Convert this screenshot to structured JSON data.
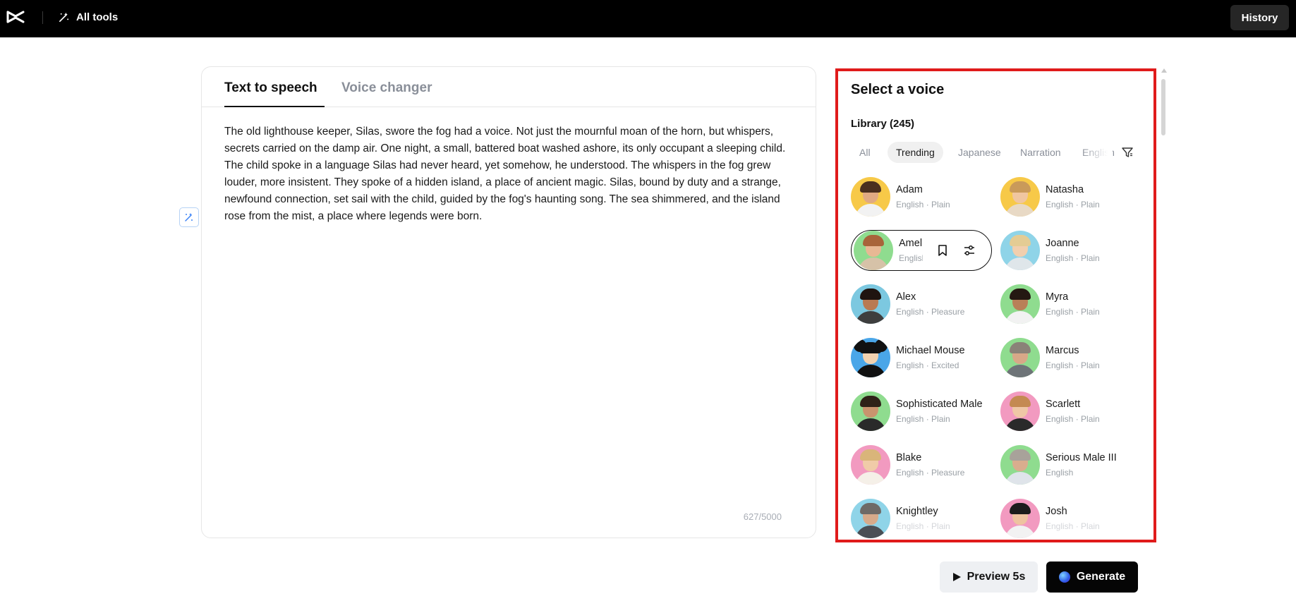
{
  "topbar": {
    "logo_icon": "capcut-logo-icon",
    "all_tools_label": "All tools",
    "all_tools_icon": "magic-wand-icon",
    "history_label": "History"
  },
  "editor": {
    "tabs": [
      {
        "label": "Text to speech",
        "active": true
      },
      {
        "label": "Voice changer",
        "active": false
      }
    ],
    "text": "The old lighthouse keeper, Silas, swore the fog had a voice. Not just the mournful moan of the horn, but whispers, secrets carried on the damp air. One night, a small, battered boat washed ashore, its only occupant a sleeping child. The child spoke in a language Silas had never heard, yet somehow, he understood. The whispers in the fog grew louder, more insistent. They spoke of a hidden island, a place of ancient magic. Silas, bound by duty and a strange, newfound connection, set sail with the child, guided by the fog's haunting song. The sea shimmered, and the island rose from the mist, a place where legends were born.",
    "char_count": "627/5000"
  },
  "voice_panel": {
    "title": "Select a voice",
    "library_label": "Library (245)",
    "filters": [
      {
        "label": "All",
        "active": false
      },
      {
        "label": "Trending",
        "active": true
      },
      {
        "label": "Japanese",
        "active": false
      },
      {
        "label": "Narration",
        "active": false
      },
      {
        "label": "English",
        "active": false
      }
    ],
    "filter_icon": "filter-icon",
    "voices": [
      {
        "name": "Adam",
        "meta": "English · Plain",
        "bg": "#f7c948",
        "skin": "#e0a982",
        "hair": "#4a2f1f",
        "shirt": "#f2f2f2"
      },
      {
        "name": "Natasha",
        "meta": "English · Plain",
        "bg": "#f7c948",
        "skin": "#f0c6a0",
        "hair": "#c99a5a",
        "shirt": "#e8d9c5"
      },
      {
        "name": "Amelia",
        "meta": "English",
        "bg": "#8fdc8f",
        "skin": "#e8b894",
        "hair": "#a8643a",
        "shirt": "#d6c2a8"
      },
      {
        "name": "Joanne",
        "meta": "English · Plain",
        "bg": "#8fd4e8",
        "skin": "#f1cfae",
        "hair": "#e4cc94",
        "shirt": "#dfe6ea"
      },
      {
        "name": "Alex",
        "meta": "English · Pleasure",
        "bg": "#7cc8e0",
        "skin": "#b97a52",
        "hair": "#1f1410",
        "shirt": "#3e3e3e"
      },
      {
        "name": "Myra",
        "meta": "English · Plain",
        "bg": "#8fdc8f",
        "skin": "#b98058",
        "hair": "#241812",
        "shirt": "#f2f2f2"
      },
      {
        "name": "Michael Mouse",
        "meta": "English · Excited",
        "bg": "#4aa6e8",
        "skin": "#f2d2b0",
        "hair": "#111111",
        "shirt": "#111111"
      },
      {
        "name": "Marcus",
        "meta": "English · Plain",
        "bg": "#8fdc8f",
        "skin": "#d8a888",
        "hair": "#8a8278",
        "shirt": "#6e7478"
      },
      {
        "name": "Sophisticated Male",
        "meta": "English · Plain",
        "bg": "#8fdc8f",
        "skin": "#c9946e",
        "hair": "#2e2218",
        "shirt": "#2a2a2a"
      },
      {
        "name": "Scarlett",
        "meta": "English · Plain",
        "bg": "#f29ac0",
        "skin": "#efc7a6",
        "hair": "#c48a52",
        "shirt": "#2a2a2a"
      },
      {
        "name": "Blake",
        "meta": "English · Pleasure",
        "bg": "#f29ac0",
        "skin": "#f0cba8",
        "hair": "#d9b57a",
        "shirt": "#f5f0e8"
      },
      {
        "name": "Serious Male III",
        "meta": "English",
        "bg": "#8fdc8f",
        "skin": "#d9ad8e",
        "hair": "#a8a29a",
        "shirt": "#dfe4ea"
      },
      {
        "name": "Knightley",
        "meta": "English · Plain",
        "bg": "#8fd4e8",
        "skin": "#d6aa8a",
        "hair": "#6e6a66",
        "shirt": "#4a4f55"
      },
      {
        "name": "Josh",
        "meta": "English · Plain",
        "bg": "#f29ac0",
        "skin": "#eec3a0",
        "hair": "#1c1c1c",
        "shirt": "#f2f2f2"
      }
    ],
    "hover_actions": [
      "bookmark-icon",
      "sliders-icon"
    ]
  },
  "actions": {
    "preview_label": "Preview 5s",
    "preview_icon": "play-icon",
    "generate_label": "Generate",
    "generate_icon": "orb-icon"
  }
}
